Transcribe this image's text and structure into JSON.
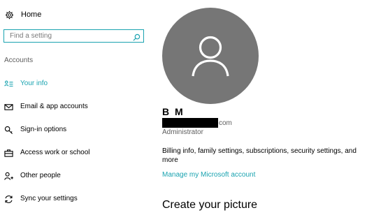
{
  "sidebar": {
    "home": {
      "label": "Home",
      "icon": "gear-icon"
    },
    "search": {
      "value": "",
      "placeholder": "Find a setting",
      "icon": "search-icon"
    },
    "section_title": "Accounts",
    "items": [
      {
        "label": "Your info",
        "icon": "your-info-icon",
        "active": true
      },
      {
        "label": "Email & app accounts",
        "icon": "email-icon",
        "active": false
      },
      {
        "label": "Sign-in options",
        "icon": "key-icon",
        "active": false
      },
      {
        "label": "Access work or school",
        "icon": "briefcase-icon",
        "active": false
      },
      {
        "label": "Other people",
        "icon": "add-person-icon",
        "active": false
      },
      {
        "label": "Sync your settings",
        "icon": "sync-icon",
        "active": false
      }
    ]
  },
  "main": {
    "user_name": "B M",
    "email_suffix": "com",
    "role": "Administrator",
    "billing_text": "Billing info, family settings, subscriptions, security settings, and more",
    "manage_link": "Manage my Microsoft account",
    "create_picture": "Create your picture"
  },
  "colors": {
    "accent": "#1aa3b0",
    "avatar": "#767676",
    "secondary_text": "#5e5e5e"
  }
}
